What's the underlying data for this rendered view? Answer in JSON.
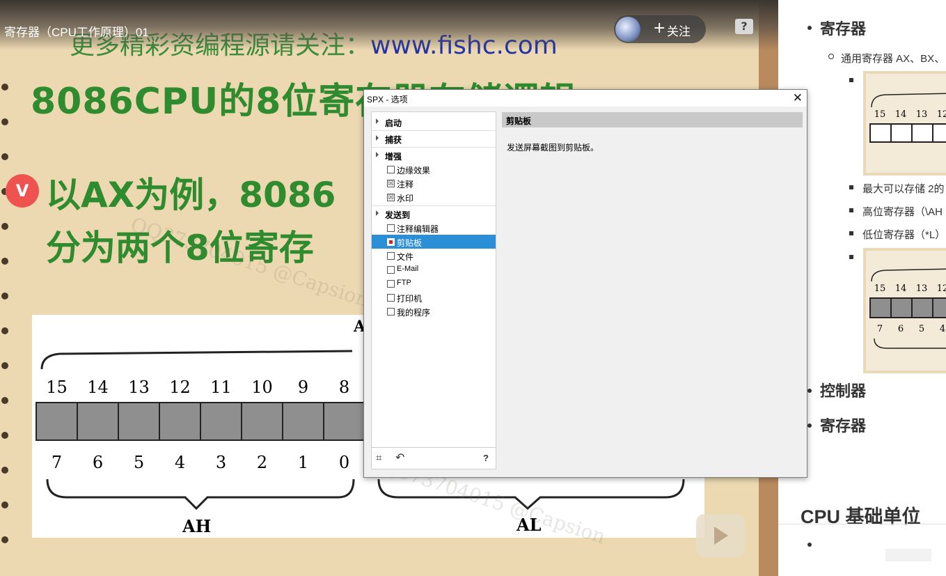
{
  "video": {
    "title": "寄存器（CPU工作原理）01",
    "follow_label": "关注",
    "follow_plus": "+",
    "help_icon": "?",
    "handwritten_url_prefix": "更多精彩资编程源请关注：",
    "handwritten_url": "www.fishc.com",
    "heading": "8086CPU的8位寄存器存储逻辑",
    "line1": "以AX为例，8086",
    "line2": "分为两个8位寄存",
    "badge": "V",
    "diagram": {
      "top_label": "A",
      "bit_numbers_high": [
        "15",
        "14",
        "13",
        "12",
        "11",
        "10",
        "9",
        "8"
      ],
      "bit_numbers_low": [
        "7",
        "6",
        "5",
        "4",
        "3",
        "2",
        "1",
        "0"
      ],
      "label_ah": "AH",
      "label_al": "AL"
    },
    "watermark": "QQ373704015 @Capsion"
  },
  "notes": {
    "item1": "寄存器",
    "sub1": "通用寄存器 AX、BX、",
    "fig1_bits": [
      "15",
      "14",
      "13",
      "12"
    ],
    "line_max": "最大可以存储 2的",
    "line_high": "高位寄存器（\\AH",
    "line_low": "低位寄存器（*L）",
    "fig2_bits_top": [
      "15",
      "14",
      "13",
      "12"
    ],
    "fig2_bits_bottom": [
      "7",
      "6",
      "5",
      "4"
    ],
    "item2": "控制器",
    "item3": "寄存器",
    "heading": "CPU 基础单位"
  },
  "dialog": {
    "title": "SPX - 选项",
    "close": "✕",
    "tree": {
      "startup": "启动",
      "capture": "捕获",
      "enhance": "增强",
      "edge_effect": "边缘效果",
      "annotation": "注释",
      "watermark": "水印",
      "send_to": "发送到",
      "annotation_editor": "注释编辑器",
      "clipboard": "剪贴板",
      "file": "文件",
      "email": "E-Mail",
      "ftp": "FTP",
      "printer": "打印机",
      "my_program": "我的程序"
    },
    "checked": {
      "annotation": "☒",
      "watermark": "☒"
    },
    "pane_title": "剪贴板",
    "pane_description": "发送屏幕截图到剪贴板。",
    "help": "?"
  }
}
